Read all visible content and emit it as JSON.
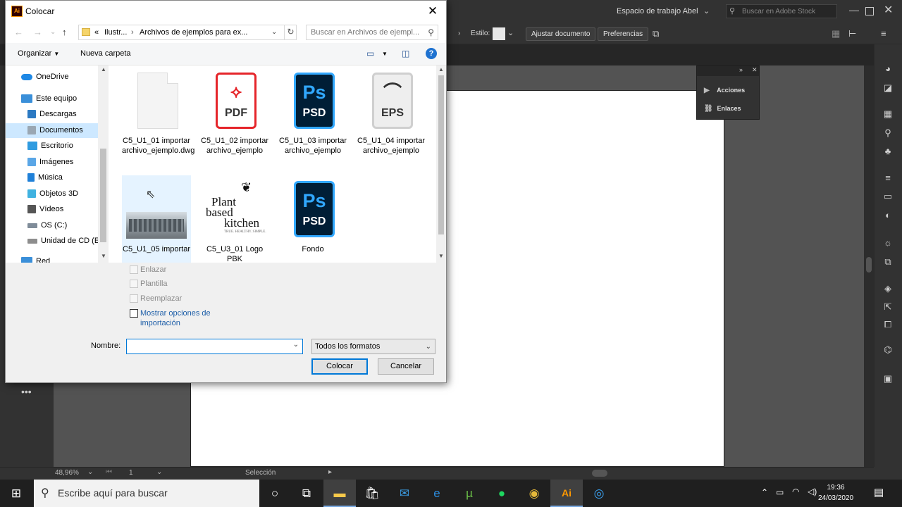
{
  "illustrator": {
    "workspace": "Espacio de trabajo Abel",
    "stock_search_placeholder": "Buscar en Adobe Stock",
    "style_label": "Estilo:",
    "fit_document_button": "Ajustar documento",
    "preferences_button": "Preferencias",
    "actions_panel": {
      "items": [
        "Acciones",
        "Enlaces"
      ]
    },
    "status": {
      "zoom": "48,96%",
      "page": "1",
      "tool": "Selección"
    }
  },
  "dialog": {
    "title": "Colocar",
    "app_icon_text": "Ai",
    "breadcrumb": {
      "prefix": "«",
      "items": [
        "Ilustr...",
        "Archivos de ejemplos para ex..."
      ]
    },
    "search_placeholder": "Buscar en Archivos de ejempl...",
    "toolbar": {
      "organize": "Organizar",
      "new_folder": "Nueva carpeta"
    },
    "nav": [
      {
        "label": "OneDrive",
        "icon": "cloud-icon",
        "color": "#1e88e5"
      },
      {
        "label": "Este equipo",
        "icon": "computer-icon",
        "color": "#3a8fd9"
      },
      {
        "label": "Descargas",
        "icon": "download-icon",
        "color": "#2b79c2"
      },
      {
        "label": "Documentos",
        "icon": "documents-icon",
        "color": "#9aa7b3",
        "selected": true
      },
      {
        "label": "Escritorio",
        "icon": "desktop-icon",
        "color": "#2f9be0"
      },
      {
        "label": "Imágenes",
        "icon": "images-icon",
        "color": "#5aa6e6"
      },
      {
        "label": "Música",
        "icon": "music-icon",
        "color": "#1f80d8"
      },
      {
        "label": "Objetos 3D",
        "icon": "3d-objects-icon",
        "color": "#40b2e0"
      },
      {
        "label": "Vídeos",
        "icon": "videos-icon",
        "color": "#555555"
      },
      {
        "label": "OS (C:)",
        "icon": "drive-icon",
        "color": "#7f8c99"
      },
      {
        "label": "Unidad de CD (E",
        "icon": "cd-drive-icon",
        "color": "#8d8d8d"
      },
      {
        "label": "Red",
        "icon": "network-icon",
        "color": "#3a8fd9"
      }
    ],
    "files": [
      {
        "name": "C5_U1_01 importar archivo_ejemplo.dwg",
        "icon_text": "",
        "kind": "blank-file-icon"
      },
      {
        "name": "C5_U1_02 importar archivo_ejemplo",
        "icon_text": "PDF",
        "kind": "pdf-file-icon"
      },
      {
        "name": "C5_U1_03 importar archivo_ejemplo",
        "icon_text": "PSD",
        "icon_sub": "Ps",
        "kind": "psd-file-icon"
      },
      {
        "name": "C5_U1_04 importar archivo_ejemplo",
        "icon_text": "EPS",
        "kind": "eps-file-icon"
      },
      {
        "name": "C5_U1_05 importar",
        "icon_text": "",
        "kind": "image-thumbnail"
      },
      {
        "name": "C5_U3_01 Logo PBK",
        "logo_lines": [
          "Plant",
          "based",
          "kitchen"
        ],
        "logo_tagline": "TRUE. HEALTHY. SIMPLE.",
        "kind": "logo-thumbnail"
      },
      {
        "name": "Fondo",
        "icon_text": "PSD",
        "icon_sub": "Ps",
        "kind": "psd-file-icon"
      }
    ],
    "options": {
      "link": "Enlazar",
      "template": "Plantilla",
      "replace": "Reemplazar",
      "show_import_options": "Mostrar opciones de importación"
    },
    "name_label": "Nombre:",
    "name_value": "",
    "format_selected": "Todos los formatos",
    "place_button": "Colocar",
    "cancel_button": "Cancelar"
  },
  "taskbar": {
    "search_placeholder": "Escribe aquí para buscar",
    "time": "19:36",
    "date": "24/03/2020"
  }
}
